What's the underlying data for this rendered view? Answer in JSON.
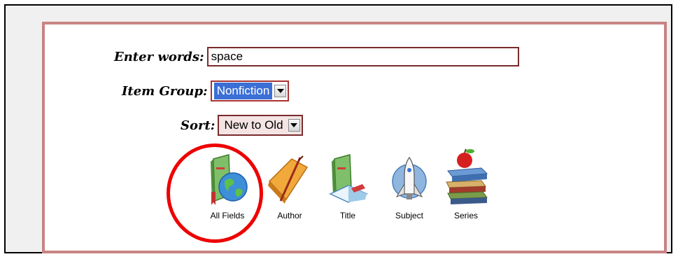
{
  "form": {
    "enter_words_label": "Enter words:",
    "enter_words_value": "space",
    "item_group_label": "Item Group:",
    "item_group_value": "Nonfiction",
    "sort_label": "Sort:",
    "sort_value": "New to Old"
  },
  "search_buttons": [
    {
      "label": "All Fields",
      "icon": "book-globe-icon",
      "highlighted": true
    },
    {
      "label": "Author",
      "icon": "book-quill-icon"
    },
    {
      "label": "Title",
      "icon": "open-book-icon"
    },
    {
      "label": "Subject",
      "icon": "space-shuttle-icon"
    },
    {
      "label": "Series",
      "icon": "book-stack-apple-icon"
    }
  ],
  "colors": {
    "panel_border": "#c88383",
    "highlight_circle": "#e00000",
    "selected_option": "#3b6fd6"
  }
}
